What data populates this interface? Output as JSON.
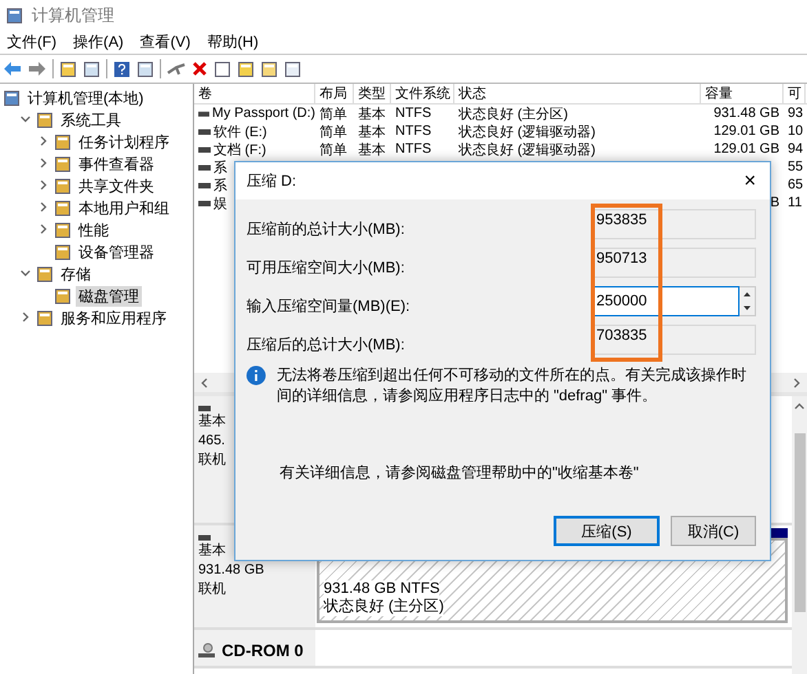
{
  "window": {
    "title": "计算机管理"
  },
  "menu": [
    "文件(F)",
    "操作(A)",
    "查看(V)",
    "帮助(H)"
  ],
  "tree": [
    {
      "label": "计算机管理(本地)",
      "selected": false,
      "children": [
        {
          "label": "系统工具",
          "selected": false,
          "expanded": true,
          "children": [
            {
              "label": "任务计划程序",
              "selected": false,
              "expanded": false
            },
            {
              "label": "事件查看器",
              "selected": false,
              "expanded": false
            },
            {
              "label": "共享文件夹",
              "selected": false,
              "expanded": false
            },
            {
              "label": "本地用户和组",
              "selected": false,
              "expanded": false
            },
            {
              "label": "性能",
              "selected": false,
              "expanded": false
            },
            {
              "label": "设备管理器",
              "selected": false
            }
          ]
        },
        {
          "label": "存储",
          "selected": false,
          "expanded": true,
          "children": [
            {
              "label": "磁盘管理",
              "selected": true
            }
          ]
        },
        {
          "label": "服务和应用程序",
          "selected": false,
          "expanded": false
        }
      ]
    }
  ],
  "volumes": {
    "columns": [
      "卷",
      "布局",
      "类型",
      "文件系统",
      "状态",
      "容量",
      "可"
    ],
    "rows": [
      [
        "My Passport (D:)",
        "简单",
        "基本",
        "NTFS",
        "状态良好 (主分区)",
        "931.48 GB",
        "93"
      ],
      [
        "软件 (E:)",
        "简单",
        "基本",
        "NTFS",
        "状态良好 (逻辑驱动器)",
        "129.01 GB",
        "10"
      ],
      [
        "文档 (F:)",
        "简单",
        "基本",
        "NTFS",
        "状态良好 (逻辑驱动器)",
        "129.01 GB",
        "94"
      ],
      [
        "系",
        null,
        null,
        null,
        null,
        null,
        "55"
      ],
      [
        "系",
        null,
        null,
        null,
        null,
        null,
        "65"
      ],
      [
        "娱",
        null,
        null,
        null,
        null,
        "B",
        "11"
      ]
    ]
  },
  "disks": [
    {
      "kind": "disk",
      "lines": [
        "基本",
        "465.",
        "联机"
      ]
    },
    {
      "kind": "disk",
      "lines": [
        "基本",
        "931.48 GB",
        "联机"
      ],
      "partition": {
        "lines": [
          "931.48 GB NTFS",
          "状态良好 (主分区)"
        ]
      }
    },
    {
      "kind": "cdrom",
      "name": "CD-ROM 0"
    }
  ],
  "dialog": {
    "title": "压缩 D:",
    "close": "×",
    "fields": [
      {
        "kind": "readonly",
        "label": "压缩前的总计大小(MB):",
        "value": "953835"
      },
      {
        "kind": "readonly",
        "label": "可用压缩空间大小(MB):",
        "value": "950713"
      },
      {
        "kind": "spin",
        "label": "输入压缩空间量(MB)(E):",
        "value": "250000"
      },
      {
        "kind": "readonly",
        "label": "压缩后的总计大小(MB):",
        "value": "703835"
      }
    ],
    "note": "无法将卷压缩到超出任何不可移动的文件所在的点。有关完成该操作时间的详细信息，请参阅应用程序日志中的 \"defrag\" 事件。",
    "help": "有关详细信息，请参阅磁盘管理帮助中的\"收缩基本卷\"",
    "buttons": [
      {
        "label": "压缩(S)",
        "default": true
      },
      {
        "label": "取消(C)",
        "default": false
      }
    ]
  }
}
